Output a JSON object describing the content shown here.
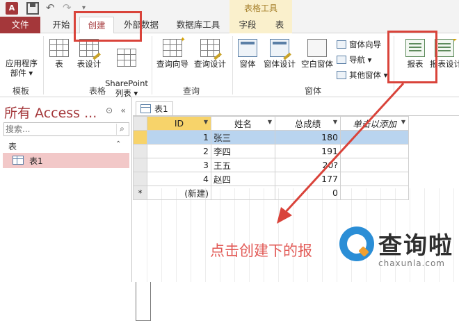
{
  "title_bar": {
    "app_icon_text": "A",
    "context_title": "表格工具"
  },
  "tabs": [
    {
      "label": "文件"
    },
    {
      "label": "开始"
    },
    {
      "label": "创建"
    },
    {
      "label": "外部数据"
    },
    {
      "label": "数据库工具"
    },
    {
      "label": "字段"
    },
    {
      "label": "表"
    }
  ],
  "ribbon": {
    "groups": {
      "templates": "模板",
      "tables": "表格",
      "queries": "查询",
      "forms": "窗体"
    },
    "buttons": {
      "app_parts": "应用程序\n部件 ▾",
      "table": "表",
      "table_design": "表设计",
      "sharepoint": "SharePoint\n列表 ▾",
      "query_wizard": "查询向导",
      "query_design": "查询设计",
      "form": "窗体",
      "form_design": "窗体设计",
      "blank_form": "空白窗体",
      "form_wizard": "窗体向导",
      "navigation": "导航 ▾",
      "more_forms": "其他窗体 ▾",
      "report": "报表",
      "report_design": "报表设计"
    }
  },
  "nav_pane": {
    "title": "所有 Access ...",
    "search_placeholder": "搜索...",
    "section": "表",
    "items": [
      {
        "label": "表1"
      }
    ]
  },
  "document": {
    "tab_label": "表1",
    "columns": [
      "ID",
      "姓名",
      "总成绩",
      "单击以添加"
    ],
    "rows": [
      {
        "id": "1",
        "name": "张三",
        "score": "180"
      },
      {
        "id": "2",
        "name": "李四",
        "score": "191"
      },
      {
        "id": "3",
        "name": "王五",
        "score": "20?"
      },
      {
        "id": "4",
        "name": "赵四",
        "score": "177"
      }
    ],
    "new_row": {
      "marker": "*",
      "id": "(新建)",
      "score": "0"
    }
  },
  "annotation": {
    "text": "点击创建下的报",
    "color": "#e25a56"
  },
  "watermark": {
    "brand": "查询啦",
    "url": "chaxunla.com"
  },
  "colors": {
    "access_red": "#a4373a",
    "highlight": "#d9433a",
    "selected_row": "#b9d4ef",
    "selected_header": "#f7d36a"
  }
}
